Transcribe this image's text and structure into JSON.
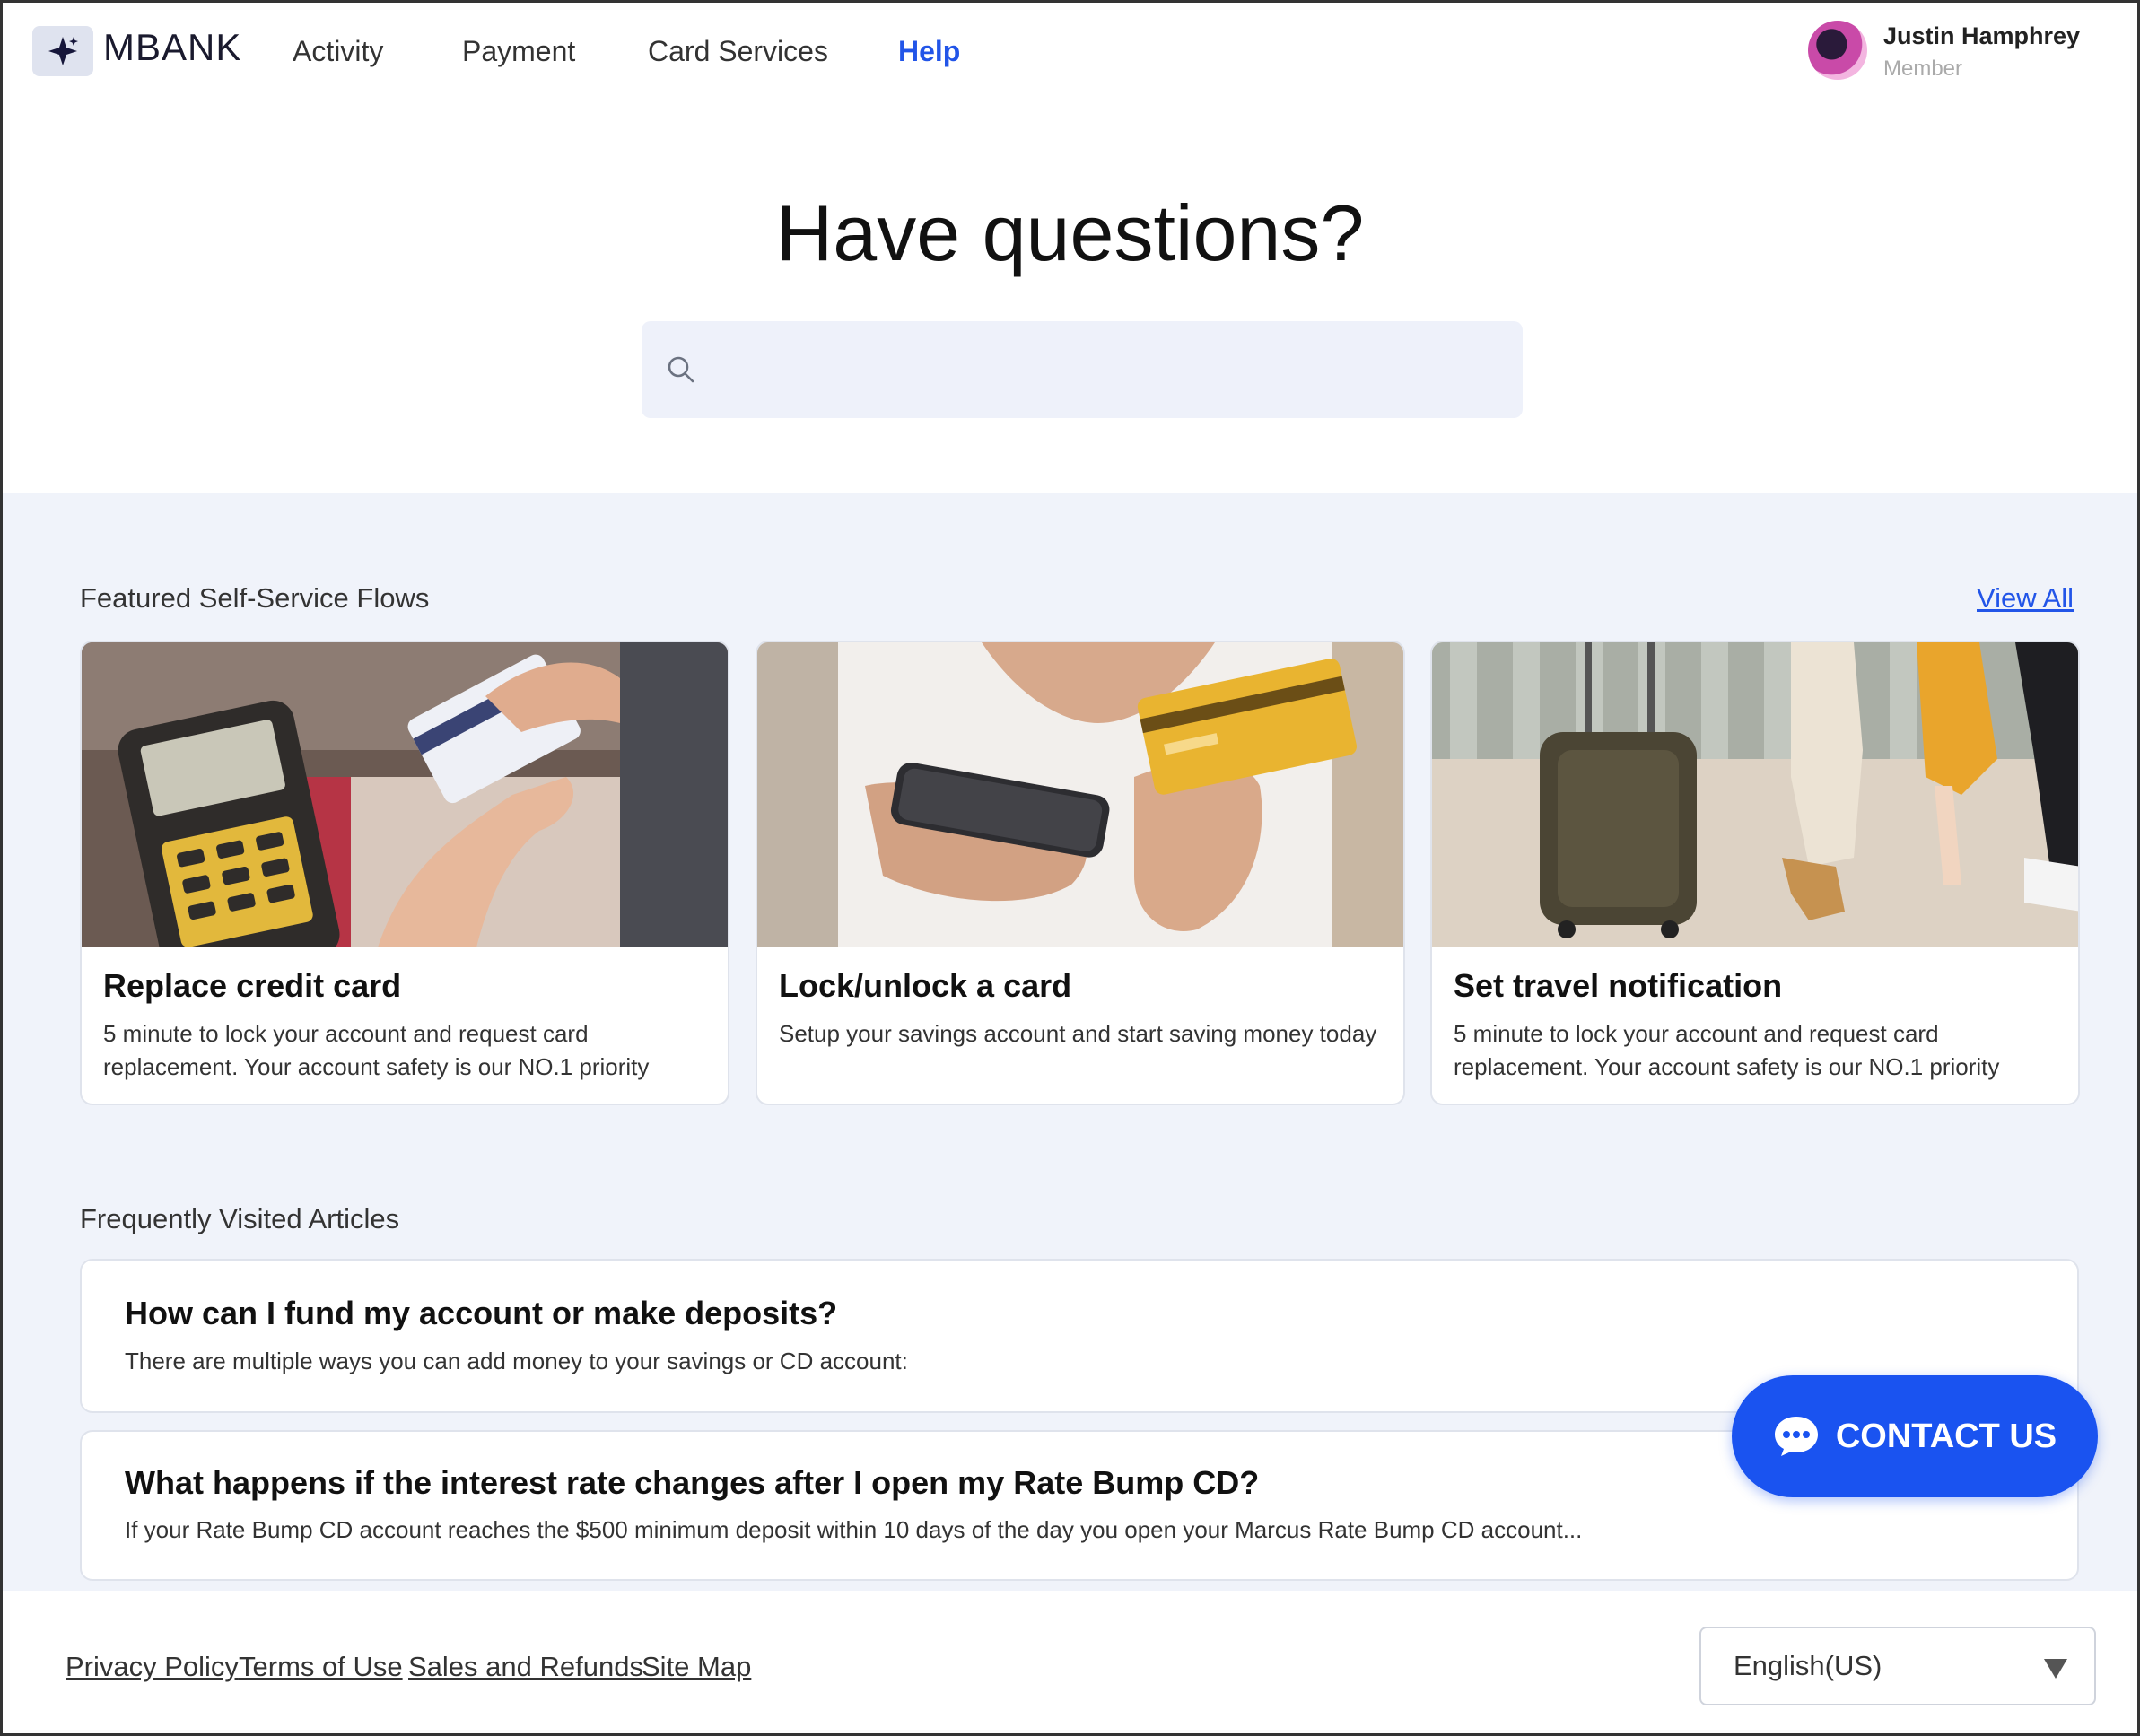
{
  "brand": {
    "name": "MBANK"
  },
  "nav": {
    "items": [
      "Activity",
      "Payment",
      "Card Services",
      "Help"
    ],
    "active": "Help"
  },
  "user": {
    "name": "Justin Hamphrey",
    "role": "Member"
  },
  "hero": {
    "title": "Have questions?",
    "search_placeholder": ""
  },
  "featured": {
    "label": "Featured Self-Service Flows",
    "view_all": "View All",
    "cards": [
      {
        "title": "Replace credit card",
        "description": "5 minute to lock your account and request card replacement. Your account safety is our NO.1 priority"
      },
      {
        "title": "Lock/unlock a card",
        "description": "Setup your savings account and start saving money today"
      },
      {
        "title": "Set travel notification",
        "description": "5 minute to lock your account and request card replacement. Your account safety is our NO.1 priority"
      }
    ]
  },
  "articles": {
    "label": "Frequently Visited Articles",
    "items": [
      {
        "title": "How can I fund my account or make deposits?",
        "description": "There are multiple ways you can add money to your savings or CD account:"
      },
      {
        "title": "What happens if the interest rate changes after I open my Rate Bump CD?",
        "description": "If your Rate Bump CD account reaches the $500 minimum deposit within 10 days of the day you open your Marcus Rate Bump CD account..."
      }
    ]
  },
  "contact": {
    "label": "CONTACT US"
  },
  "footer": {
    "links": [
      "Privacy Policy",
      "Terms of Use",
      "Sales and Refunds",
      "Site Map"
    ],
    "language": "English(US)"
  },
  "colors": {
    "accent": "#1a53f0",
    "band": "#f0f3fa",
    "nav_active": "#2255e8"
  }
}
